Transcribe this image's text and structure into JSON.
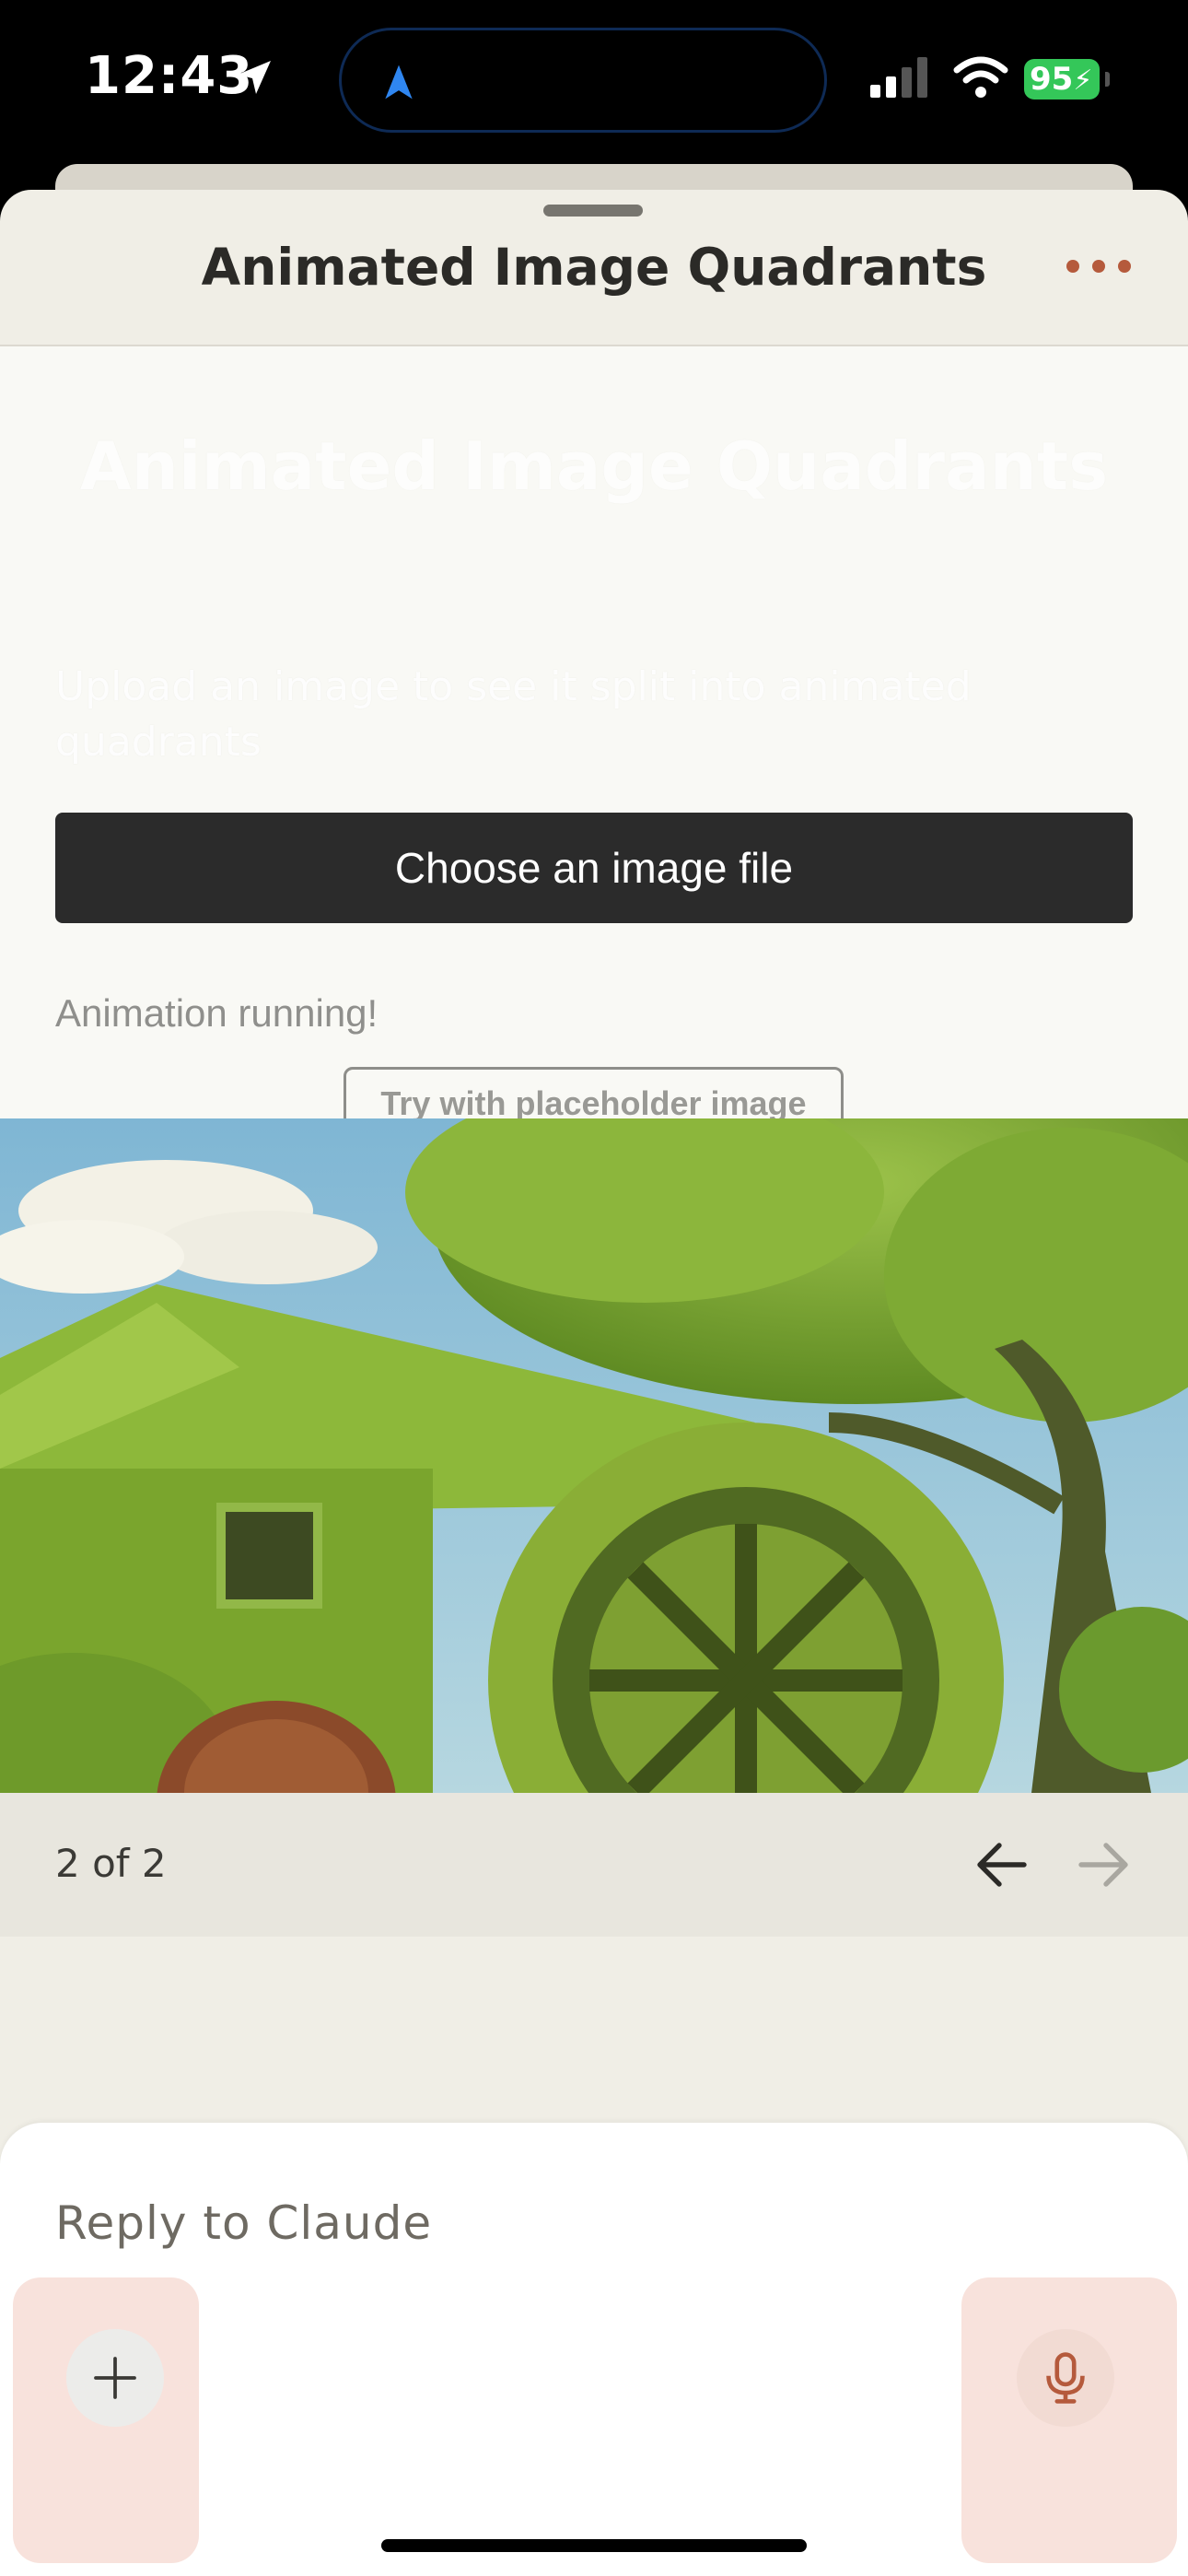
{
  "status_bar": {
    "time": "12:43",
    "battery": "95",
    "icons": [
      "location-arrow-icon",
      "navigation-icon",
      "cellular-signal-icon",
      "wifi-icon",
      "battery-charging-icon"
    ]
  },
  "sheet": {
    "title": "Animated Image Quadrants",
    "menu_icon": "more-horizontal-icon"
  },
  "artifact": {
    "heading": "Animated Image Quadrants",
    "description": "Upload an image to see it split into animated quadrants",
    "choose_button": "Choose an image file",
    "status": "Animation running!",
    "placeholder_button": "Try with placeholder image"
  },
  "pager": {
    "label": "2 of 2",
    "prev_icon": "arrow-left-icon",
    "next_icon": "arrow-right-icon"
  },
  "composer": {
    "placeholder": "Reply to Claude",
    "add_icon": "plus-icon",
    "mic_icon": "microphone-icon"
  },
  "colors": {
    "accent": "#b55a3c",
    "battery": "#34c759",
    "button_dark": "#2b2b2b"
  }
}
